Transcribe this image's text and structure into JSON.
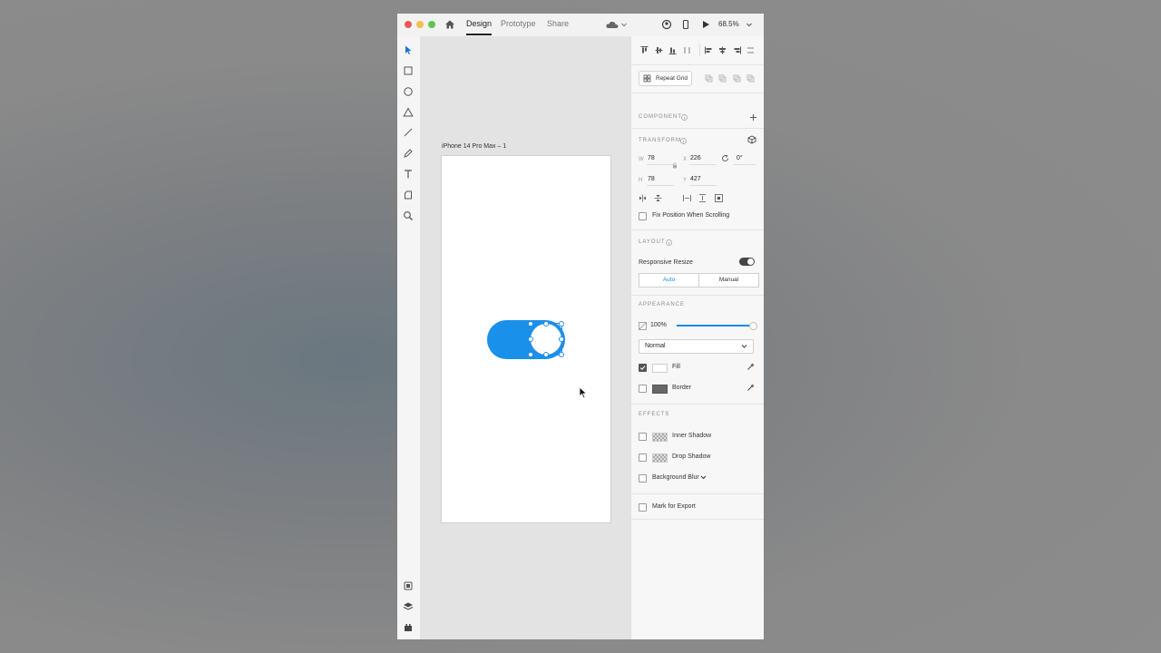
{
  "titlebar": {
    "tabs": [
      "Design",
      "Prototype",
      "Share"
    ],
    "active_tab": "Design",
    "zoom": "68.5%"
  },
  "canvas": {
    "artboard_name": "iPhone 14 Pro Max – 1",
    "toggle_color": "#1990ea"
  },
  "inspector": {
    "repeat_grid": "Repeat Grid",
    "component_header": "COMPONENT",
    "transform_header": "TRANSFORM",
    "w_label": "W",
    "w_value": "78",
    "x_label": "X",
    "x_value": "226",
    "rotation_value": "0°",
    "h_label": "H",
    "h_value": "78",
    "y_label": "Y",
    "y_value": "427",
    "fix_position": "Fix Position When Scrolling",
    "layout_header": "LAYOUT",
    "responsive_resize": "Responsive Resize",
    "responsive_auto": "Auto",
    "responsive_manual": "Manual",
    "appearance_header": "APPEARANCE",
    "opacity": "100%",
    "opacity_fraction": 1.0,
    "blend_mode": "Normal",
    "fill_label": "Fill",
    "fill_checked": true,
    "border_label": "Border",
    "border_checked": false,
    "effects_header": "EFFECTS",
    "inner_shadow": "Inner Shadow",
    "drop_shadow": "Drop Shadow",
    "background_blur": "Background Blur",
    "mark_export": "Mark for Export",
    "accent_color": "#1a8ae4"
  }
}
